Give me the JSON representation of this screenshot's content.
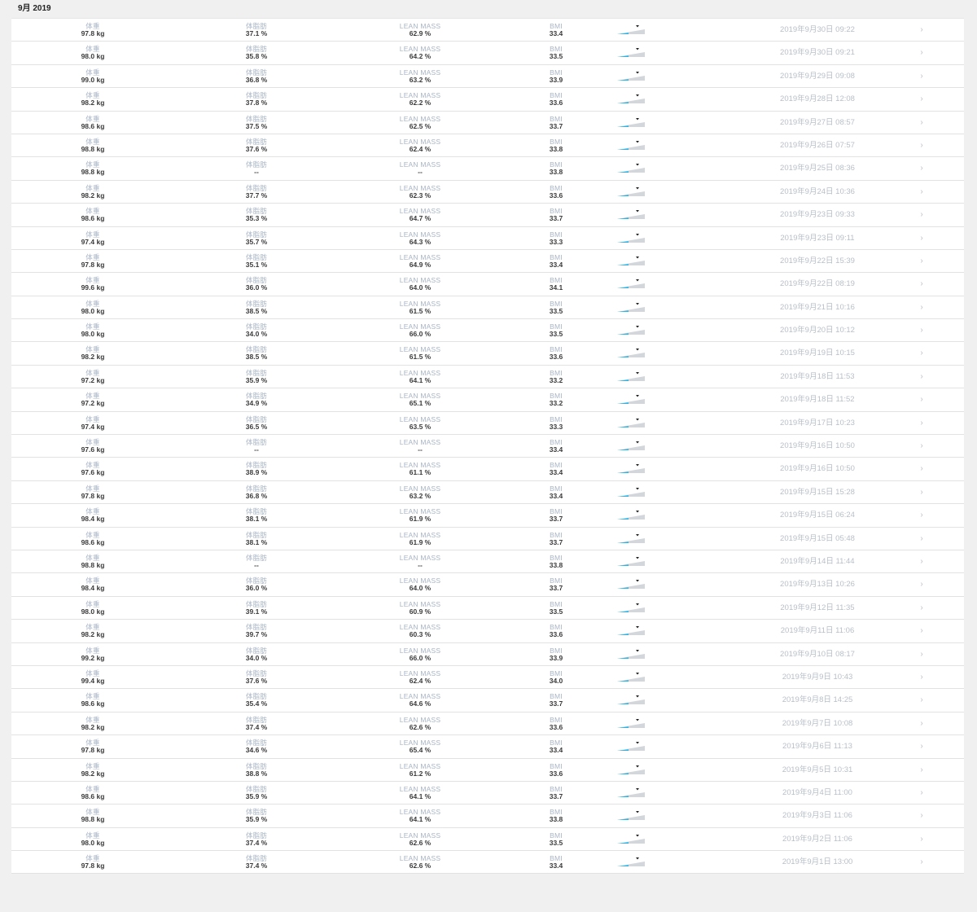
{
  "month_header": "9月 2019",
  "labels": {
    "weight": "体重",
    "fat": "体脂肪",
    "lean": "LEAN MASS",
    "bmi": "BMI"
  },
  "icons": {
    "row_chevron": "chevron-right-icon",
    "sparkline": "bmi-gauge-icon"
  },
  "colors": {
    "gauge_fill": "#29b6e6",
    "gauge_track": "#d3d6da",
    "label": "#a9b5c6"
  },
  "rows": [
    {
      "weight": "97.8 kg",
      "fat": "37.1 %",
      "lean": "62.9 %",
      "bmi": "33.4",
      "date": "2019年9月30日 09:22"
    },
    {
      "weight": "98.0 kg",
      "fat": "35.8 %",
      "lean": "64.2 %",
      "bmi": "33.5",
      "date": "2019年9月30日 09:21"
    },
    {
      "weight": "99.0 kg",
      "fat": "36.8 %",
      "lean": "63.2 %",
      "bmi": "33.9",
      "date": "2019年9月29日 09:08"
    },
    {
      "weight": "98.2 kg",
      "fat": "37.8 %",
      "lean": "62.2 %",
      "bmi": "33.6",
      "date": "2019年9月28日 12:08"
    },
    {
      "weight": "98.6 kg",
      "fat": "37.5 %",
      "lean": "62.5 %",
      "bmi": "33.7",
      "date": "2019年9月27日 08:57"
    },
    {
      "weight": "98.8 kg",
      "fat": "37.6 %",
      "lean": "62.4 %",
      "bmi": "33.8",
      "date": "2019年9月26日 07:57"
    },
    {
      "weight": "98.8 kg",
      "fat": "--",
      "lean": "--",
      "bmi": "33.8",
      "date": "2019年9月25日 08:36"
    },
    {
      "weight": "98.2 kg",
      "fat": "37.7 %",
      "lean": "62.3 %",
      "bmi": "33.6",
      "date": "2019年9月24日 10:36"
    },
    {
      "weight": "98.6 kg",
      "fat": "35.3 %",
      "lean": "64.7 %",
      "bmi": "33.7",
      "date": "2019年9月23日 09:33"
    },
    {
      "weight": "97.4 kg",
      "fat": "35.7 %",
      "lean": "64.3 %",
      "bmi": "33.3",
      "date": "2019年9月23日 09:11"
    },
    {
      "weight": "97.8 kg",
      "fat": "35.1 %",
      "lean": "64.9 %",
      "bmi": "33.4",
      "date": "2019年9月22日 15:39"
    },
    {
      "weight": "99.6 kg",
      "fat": "36.0 %",
      "lean": "64.0 %",
      "bmi": "34.1",
      "date": "2019年9月22日 08:19"
    },
    {
      "weight": "98.0 kg",
      "fat": "38.5 %",
      "lean": "61.5 %",
      "bmi": "33.5",
      "date": "2019年9月21日 10:16"
    },
    {
      "weight": "98.0 kg",
      "fat": "34.0 %",
      "lean": "66.0 %",
      "bmi": "33.5",
      "date": "2019年9月20日 10:12"
    },
    {
      "weight": "98.2 kg",
      "fat": "38.5 %",
      "lean": "61.5 %",
      "bmi": "33.6",
      "date": "2019年9月19日 10:15"
    },
    {
      "weight": "97.2 kg",
      "fat": "35.9 %",
      "lean": "64.1 %",
      "bmi": "33.2",
      "date": "2019年9月18日 11:53"
    },
    {
      "weight": "97.2 kg",
      "fat": "34.9 %",
      "lean": "65.1 %",
      "bmi": "33.2",
      "date": "2019年9月18日 11:52"
    },
    {
      "weight": "97.4 kg",
      "fat": "36.5 %",
      "lean": "63.5 %",
      "bmi": "33.3",
      "date": "2019年9月17日 10:23"
    },
    {
      "weight": "97.6 kg",
      "fat": "--",
      "lean": "--",
      "bmi": "33.4",
      "date": "2019年9月16日 10:50"
    },
    {
      "weight": "97.6 kg",
      "fat": "38.9 %",
      "lean": "61.1 %",
      "bmi": "33.4",
      "date": "2019年9月16日 10:50"
    },
    {
      "weight": "97.8 kg",
      "fat": "36.8 %",
      "lean": "63.2 %",
      "bmi": "33.4",
      "date": "2019年9月15日 15:28"
    },
    {
      "weight": "98.4 kg",
      "fat": "38.1 %",
      "lean": "61.9 %",
      "bmi": "33.7",
      "date": "2019年9月15日 06:24"
    },
    {
      "weight": "98.6 kg",
      "fat": "38.1 %",
      "lean": "61.9 %",
      "bmi": "33.7",
      "date": "2019年9月15日 05:48"
    },
    {
      "weight": "98.8 kg",
      "fat": "--",
      "lean": "--",
      "bmi": "33.8",
      "date": "2019年9月14日 11:44"
    },
    {
      "weight": "98.4 kg",
      "fat": "36.0 %",
      "lean": "64.0 %",
      "bmi": "33.7",
      "date": "2019年9月13日 10:26"
    },
    {
      "weight": "98.0 kg",
      "fat": "39.1 %",
      "lean": "60.9 %",
      "bmi": "33.5",
      "date": "2019年9月12日 11:35"
    },
    {
      "weight": "98.2 kg",
      "fat": "39.7 %",
      "lean": "60.3 %",
      "bmi": "33.6",
      "date": "2019年9月11日 11:06"
    },
    {
      "weight": "99.2 kg",
      "fat": "34.0 %",
      "lean": "66.0 %",
      "bmi": "33.9",
      "date": "2019年9月10日 08:17"
    },
    {
      "weight": "99.4 kg",
      "fat": "37.6 %",
      "lean": "62.4 %",
      "bmi": "34.0",
      "date": "2019年9月9日 10:43"
    },
    {
      "weight": "98.6 kg",
      "fat": "35.4 %",
      "lean": "64.6 %",
      "bmi": "33.7",
      "date": "2019年9月8日 14:25"
    },
    {
      "weight": "98.2 kg",
      "fat": "37.4 %",
      "lean": "62.6 %",
      "bmi": "33.6",
      "date": "2019年9月7日 10:08"
    },
    {
      "weight": "97.8 kg",
      "fat": "34.6 %",
      "lean": "65.4 %",
      "bmi": "33.4",
      "date": "2019年9月6日 11:13"
    },
    {
      "weight": "98.2 kg",
      "fat": "38.8 %",
      "lean": "61.2 %",
      "bmi": "33.6",
      "date": "2019年9月5日 10:31"
    },
    {
      "weight": "98.6 kg",
      "fat": "35.9 %",
      "lean": "64.1 %",
      "bmi": "33.7",
      "date": "2019年9月4日 11:00"
    },
    {
      "weight": "98.8 kg",
      "fat": "35.9 %",
      "lean": "64.1 %",
      "bmi": "33.8",
      "date": "2019年9月3日 11:06"
    },
    {
      "weight": "98.0 kg",
      "fat": "37.4 %",
      "lean": "62.6 %",
      "bmi": "33.5",
      "date": "2019年9月2日 11:06"
    },
    {
      "weight": "97.8 kg",
      "fat": "37.4 %",
      "lean": "62.6 %",
      "bmi": "33.4",
      "date": "2019年9月1日 13:00"
    }
  ]
}
